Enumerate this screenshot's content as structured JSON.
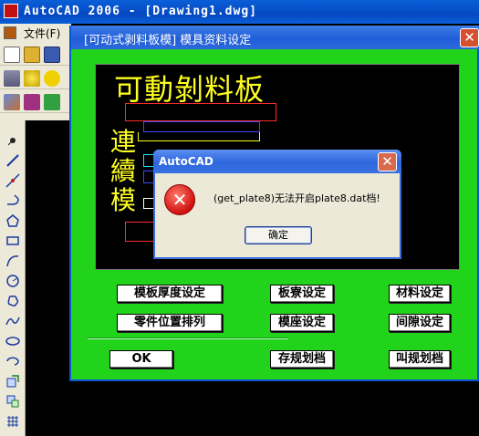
{
  "app": {
    "title": "AutoCAD 2006 - [Drawing1.dwg]",
    "menu_file": "文件(F)"
  },
  "dialog": {
    "title": "[可动式剥料板模] 模具资料设定",
    "preview": {
      "title": "可動剝料板",
      "side_chars": [
        "連",
        "續",
        "模"
      ]
    },
    "buttons": {
      "plate_thickness": "模板厚度设定",
      "plate_gap": "板寮设定",
      "material": "材料设定",
      "part_position": "零件位置排列",
      "die_base": "模座设定",
      "clearance": "间隙设定",
      "ok": "OK",
      "save_plan": "存规划档",
      "load_plan": "叫规划档"
    }
  },
  "error_dialog": {
    "title": "AutoCAD",
    "message": "(get_plate8)无法开启plate8.dat档!",
    "ok_label": "确定",
    "icon": "error-icon"
  },
  "colors": {
    "dialog_bg": "#22d31c",
    "preview_text": "#ffff20",
    "titlebar": "#1f5dd8"
  }
}
